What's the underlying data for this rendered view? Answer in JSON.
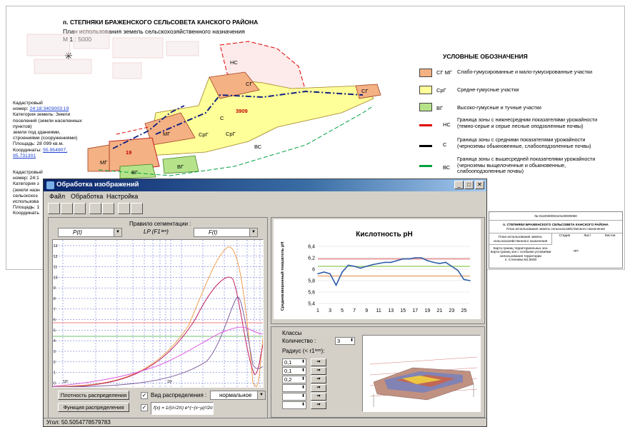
{
  "map": {
    "title": "п. СТЕПНЯКИ БРАЖЕНСКОГО СЕЛЬСОВЕТА КАНСКОГО РАЙОНА",
    "subtitle": "План использования земель сельскохозяйственного назначения",
    "scale": "М 1 : 5000",
    "zone_labels": [
      "НС",
      "СГ",
      "СГ",
      "3909",
      "С",
      "СрГ",
      "СрГ",
      "МГ",
      "19",
      "МГ",
      "ВГ",
      "ВГ",
      "ВС"
    ],
    "legend_title": "УСЛОВНЫЕ ОБОЗНАЧЕНИЯ",
    "legend": [
      {
        "code": "СГ МГ",
        "text": "Слабо-гумусированные и мало-гумусированные участки",
        "color": "#f4b183"
      },
      {
        "code": "СрГ",
        "text": "Средне-гумусные участки",
        "color": "#ffff99"
      },
      {
        "code": "ВГ",
        "text": "Высоко-гумусные и тучные участки",
        "color": "#b6e38a"
      },
      {
        "code": "НС",
        "text": "Граница зоны с нижнесредним показателями урожайности (темно-серые и серые лесные оподзоленные почвы)",
        "color": "#e00000"
      },
      {
        "code": "С",
        "text": "Граница зоны с средними показателями урожайности (черноземы обыкновенные, слабооподзоленные почвы)",
        "color": "#000000"
      },
      {
        "code": "ВС",
        "text": "Граница зоны с вышесредней показателями урожайности (черноземы выщелоченные и обыкновенные, слабооподзоленные почвы)",
        "color": "#00a040"
      }
    ],
    "cadastral1": {
      "l1": "Кадастровый",
      "l2": "номер:",
      "num": "24:18:3403003:19",
      "l3": "Категория земель: Земли поселений (земли населенных пунктов)",
      "l4": "земли под зданиями, строениями (сооружениями)",
      "l5": "Площадь: 28 099 кв.м.",
      "l6": "Координаты:",
      "coord": "55.954907, 95.731301"
    },
    "cadastral2": {
      "l1": "Кадастровый",
      "l2": "номер: 24:1",
      "l3": "Категория з",
      "l4": "(земли назн",
      "l5": "сельскохоз",
      "l6": "использова",
      "l7": "Площадь: 1",
      "l8": "Координать"
    }
  },
  "doc_stamp": {
    "num": "№ 011003000210120000050",
    "l1": "п. СТЕПНЯКИ БРАЖЕНСКОГО СЕЛЬСОВЕТА КАНСКОГО РАЙОНА",
    "l2": "План использования земель сельскохозяйственного назначения",
    "r1": "План использования земель",
    "r2": "сельскохозяйственного назначения",
    "r3": "Карта границ территориальных зон.",
    "r4": "Карта границ зон с особыми условиями использования территории",
    "r5": "п. Степняки М1:5000",
    "c1": "Стадия",
    "c2": "Лист",
    "c3": "Листов",
    "val": "ПП"
  },
  "window": {
    "title": "Обработка изображений",
    "menu": [
      "Файл",
      "Обработка",
      "Настройка"
    ],
    "segmentation_label": "Правило сегментации :",
    "formula": "LP (F1ⁱᵉᵐ)",
    "left_combo": "P(t)",
    "right_combo": "F(t)",
    "density_btn": "Плотность распределения",
    "func_btn": "Функция распределения",
    "dist_type_label": "Вид распределения :",
    "dist_type_value": "нормальное",
    "pdf_formula": "f(x) = 1/(σ√2π) e^(−(x−μ)²/2σ²)",
    "classes_label": "Классы",
    "count_label": "Количество :",
    "count_value": "3",
    "radius_label": "Радиус  (< r1ⁱᵉᵐ):",
    "radius_values": [
      "0,1",
      "0,1",
      "0,2",
      "",
      "",
      ""
    ],
    "status": "Угол: 50.5054778579783"
  },
  "chart_data": {
    "type": "line",
    "title": "Кислотность pH",
    "ylabel": "Средневзвешенный показатель pH",
    "x_ticks": [
      "1",
      "3",
      "5",
      "7",
      "9",
      "11",
      "13",
      "15",
      "17",
      "19",
      "21",
      "23",
      "25"
    ],
    "y_ticks": [
      "5,4",
      "5,6",
      "5,8",
      "6",
      "6,2",
      "6,4"
    ],
    "ylim": [
      5.4,
      6.4
    ],
    "x": [
      1,
      2,
      3,
      4,
      5,
      6,
      7,
      8,
      9,
      10,
      11,
      12,
      13,
      14,
      15,
      16,
      17,
      18,
      19,
      20,
      21,
      22,
      23,
      24,
      25,
      26
    ],
    "series": [
      {
        "values": [
          5.92,
          5.95,
          5.92,
          5.72,
          5.95,
          6.07,
          6.05,
          6.02,
          6.05,
          6.08,
          6.1,
          6.12,
          6.12,
          6.15,
          6.18,
          6.18,
          6.2,
          6.2,
          6.15,
          6.12,
          6.1,
          6.12,
          6.05,
          5.98,
          5.82,
          5.8
        ],
        "color": "#2e5ca8"
      }
    ],
    "reference_lines": [
      {
        "value": 6.18,
        "color": "#e89090"
      },
      {
        "value": 6.05,
        "color": "#a0d070"
      },
      {
        "value": 5.88,
        "color": "#f0b080"
      }
    ]
  },
  "colors": {
    "title_bar": "#0a246a",
    "window_bg": "#d4d0c8"
  }
}
